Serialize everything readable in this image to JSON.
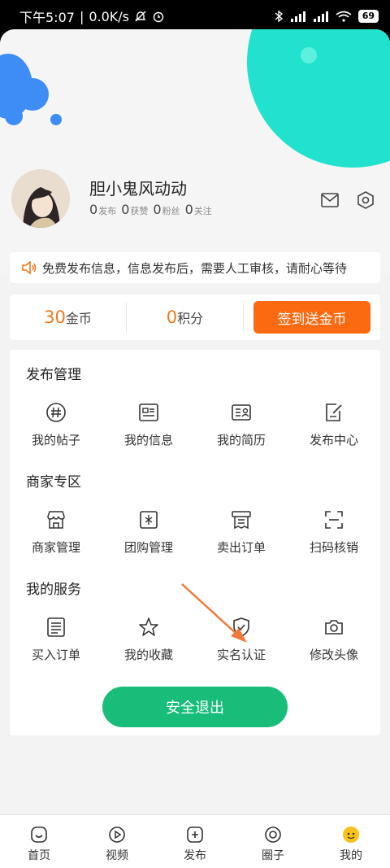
{
  "status_bar": {
    "time": "下午5:07",
    "speed": "0.0K/s",
    "battery": "69"
  },
  "profile": {
    "username": "胆小鬼风动动",
    "stats": [
      {
        "num": "0",
        "label": "发布"
      },
      {
        "num": "0",
        "label": "获赞"
      },
      {
        "num": "0",
        "label": "粉丝"
      },
      {
        "num": "0",
        "label": "关注"
      }
    ]
  },
  "notice": {
    "text": "免费发布信息，信息发布后，需要人工审核，请耐心等待"
  },
  "wallet": {
    "coins_num": "30",
    "coins_label": "金币",
    "points_num": "0",
    "points_label": "积分",
    "sign_in_label": "签到送金币"
  },
  "sections": {
    "publish": {
      "title": "发布管理",
      "items": [
        {
          "label": "我的帖子",
          "icon": "hashtag-icon"
        },
        {
          "label": "我的信息",
          "icon": "info-card-icon"
        },
        {
          "label": "我的简历",
          "icon": "resume-icon"
        },
        {
          "label": "发布中心",
          "icon": "edit-icon"
        }
      ]
    },
    "merchant": {
      "title": "商家专区",
      "items": [
        {
          "label": "商家管理",
          "icon": "store-icon"
        },
        {
          "label": "团购管理",
          "icon": "group-buy-icon"
        },
        {
          "label": "卖出订单",
          "icon": "receipt-icon"
        },
        {
          "label": "扫码核销",
          "icon": "scan-icon"
        }
      ]
    },
    "services": {
      "title": "我的服务",
      "items": [
        {
          "label": "买入订单",
          "icon": "order-list-icon"
        },
        {
          "label": "我的收藏",
          "icon": "star-icon"
        },
        {
          "label": "实名认证",
          "icon": "shield-check-icon"
        },
        {
          "label": "修改头像",
          "icon": "camera-icon"
        }
      ]
    }
  },
  "logout_label": "安全退出",
  "tabbar": [
    {
      "label": "首页",
      "icon": "home-icon"
    },
    {
      "label": "视频",
      "icon": "video-icon"
    },
    {
      "label": "发布",
      "icon": "add-icon"
    },
    {
      "label": "圈子",
      "icon": "circle-icon"
    },
    {
      "label": "我的",
      "icon": "me-icon"
    }
  ],
  "colors": {
    "accent_orange": "#fb6a10",
    "coin_orange": "#f07a1a",
    "logout_green": "#17bd79",
    "teal": "#21e3cd",
    "blue": "#3e8cf5"
  }
}
